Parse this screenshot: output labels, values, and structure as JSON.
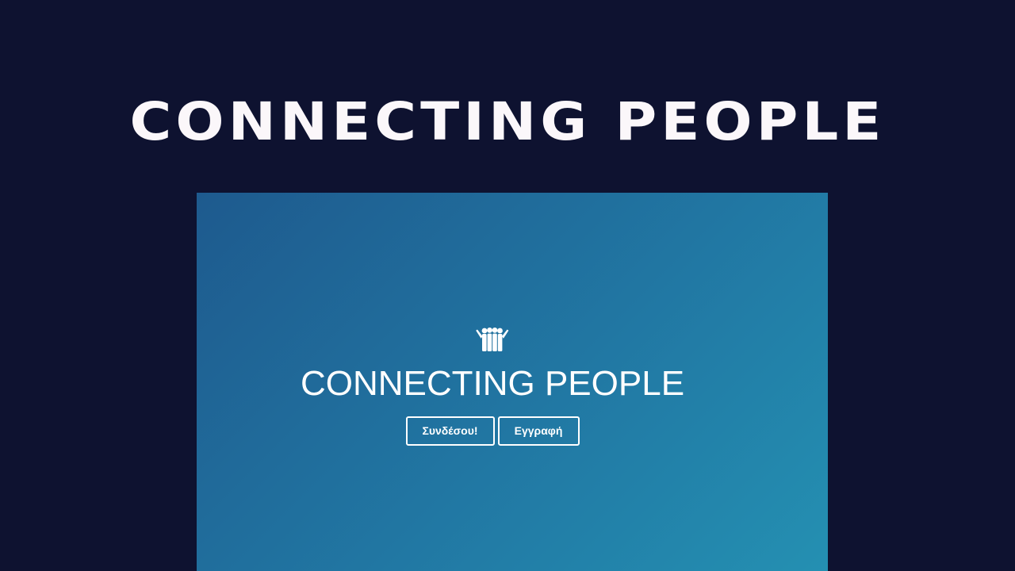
{
  "banner": {
    "title": "CONNECTING PEOPLE"
  },
  "preview": {
    "logo_icon": "people-group-icon",
    "title": "CONNECTING PEOPLE",
    "buttons": {
      "login_label": "Συνδέσου!",
      "register_label": "Εγγραφή"
    }
  },
  "colors": {
    "page_background": "#0e1230",
    "banner_text": "#fbf7fa",
    "gradient_start": "#1e5a8e",
    "gradient_end": "#2490b2",
    "hero_text": "#ffffff"
  }
}
